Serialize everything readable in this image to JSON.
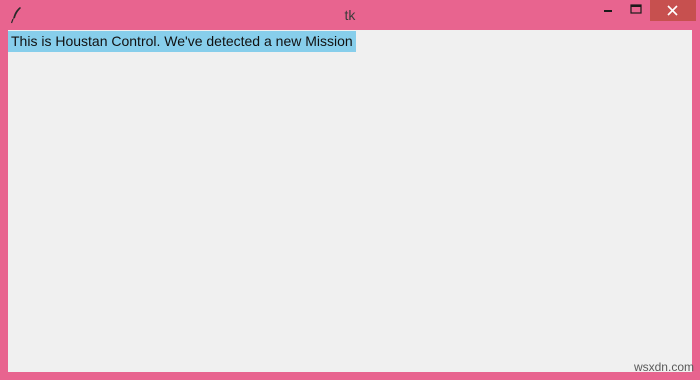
{
  "window": {
    "title": "tk",
    "icon": "feather-icon",
    "controls": [
      "minimize-icon",
      "maximize-icon",
      "close-icon"
    ],
    "frame_color": "#e8648f",
    "close_hover_color": "#c7504f"
  },
  "content": {
    "label_text": "This is Houstan Control. We've detected a new Mission",
    "label_bg": "#87ceeb",
    "background": "#f0f0f0"
  },
  "watermark": "wsxdn.com"
}
